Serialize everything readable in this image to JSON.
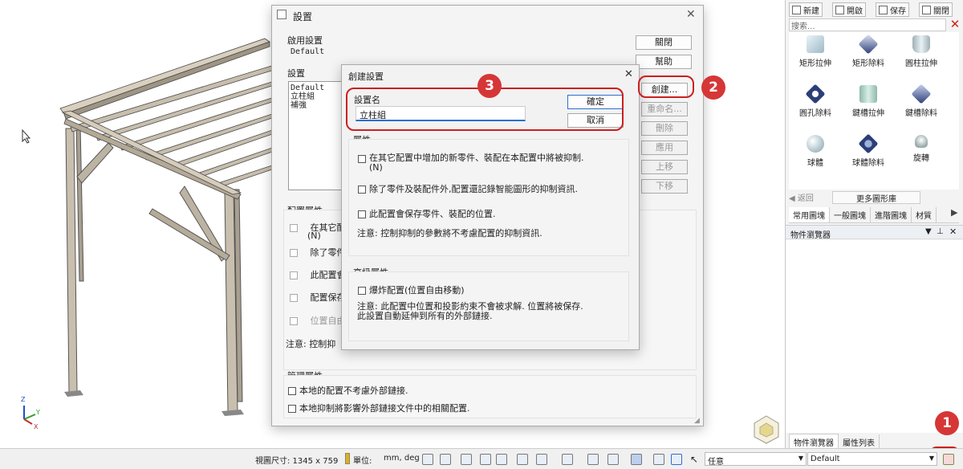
{
  "statusbar": {
    "view_size": "視圖尺寸: 1345 x  759",
    "units_label": "單位:",
    "units_value": "mm, deg",
    "filter_value": "任意",
    "config_value": "Default"
  },
  "catalog": {
    "toolbar": {
      "new": "新建",
      "open": "開啟",
      "save": "保存",
      "close": "關閉"
    },
    "search_placeholder": "搜索...",
    "items": [
      {
        "label": "矩形拉伸",
        "icon": "rect-extrude-icon"
      },
      {
        "label": "矩形除料",
        "icon": "rect-cut-icon"
      },
      {
        "label": "圓柱拉伸",
        "icon": "cylinder-extrude-icon"
      },
      {
        "label": "圓孔除料",
        "icon": "hole-cut-icon"
      },
      {
        "label": "鍵槽拉伸",
        "icon": "slot-extrude-icon"
      },
      {
        "label": "鍵槽除料",
        "icon": "slot-cut-icon"
      },
      {
        "label": "球體",
        "icon": "sphere-icon"
      },
      {
        "label": "球體除料",
        "icon": "sphere-cut-icon"
      },
      {
        "label": "旋轉",
        "icon": "revolve-icon"
      }
    ],
    "back": "返回",
    "more": "更多圖形庫",
    "tabs": [
      "常用圖塊",
      "一般圖塊",
      "進階圖塊",
      "材質"
    ]
  },
  "browser": {
    "title": "物件瀏覽器",
    "tabs": [
      "物件瀏覽器",
      "屬性列表"
    ]
  },
  "settings_dialog": {
    "title": "設置",
    "active_label": "啟用設置",
    "active_value": "Default",
    "settings_label": "設置",
    "settings_list": [
      "Default",
      "立柱組",
      "補強"
    ],
    "buttons": {
      "close": "關閉",
      "help": "幫助",
      "create": "創建...",
      "rename": "重命名...",
      "delete": "刪除",
      "apply": "應用",
      "up": "上移",
      "down": "下移"
    },
    "config_props_label": "配置屬性",
    "config_props": [
      "在其它配",
      "除了零件",
      "此配置會",
      "配置保存",
      "位置自由"
    ],
    "config_props_extra": "(N)",
    "note": "注意: 控制抑",
    "manage_label": "管理屬性",
    "manage_items": [
      "本地的配置不考慮外部鏈接.",
      "本地抑制將影響外部鏈接文件中的相關配置."
    ]
  },
  "create_dialog": {
    "title": "創建設置",
    "name_label": "設置名",
    "name_value": "立柱組",
    "ok": "確定",
    "cancel": "取消",
    "props_label": "屬性",
    "props": [
      "在其它配置中增加的新零件、裝配在本配置中將被抑制.\n(N)",
      "除了零件及裝配件外,配置還記錄智能圖形的抑制資訊.",
      "此配置會保存零件、裝配的位置."
    ],
    "props_note": "注意: 控制抑制的參數將不考慮配置的抑制資訊.",
    "adv_label": "高級屬性",
    "adv_item": "爆炸配置(位置自由移動)",
    "adv_note": "注意: 此配置中位置和投影約束不會被求解. 位置將被保存.\n此設置自動延伸到所有的外部鏈接."
  },
  "badges": [
    "1",
    "2",
    "3"
  ],
  "colors": {
    "highlight": "#cc1f1f",
    "badge": "#d63636",
    "accent": "#2b6fd6"
  }
}
